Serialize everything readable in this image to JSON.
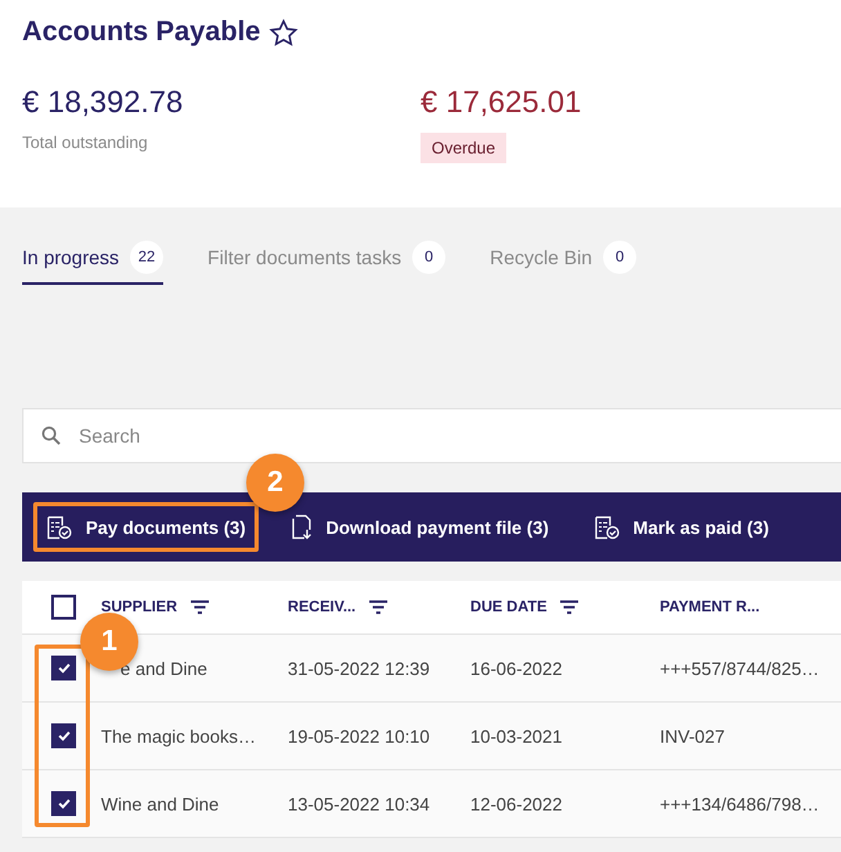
{
  "header": {
    "title": "Accounts Payable",
    "favorite": false
  },
  "summary": [
    {
      "amount": "€ 18,392.78",
      "label": "Total outstanding",
      "kind": "total"
    },
    {
      "amount": "€ 17,625.01",
      "label": "Overdue",
      "kind": "overdue"
    }
  ],
  "tabs": [
    {
      "label": "In progress",
      "count": "22",
      "selected": true
    },
    {
      "label": "Filter documents tasks",
      "count": "0",
      "selected": false
    },
    {
      "label": "Recycle Bin",
      "count": "0",
      "selected": false
    }
  ],
  "search": {
    "placeholder": "Search"
  },
  "actions": [
    {
      "label": "Pay documents (3)",
      "kind": "pay",
      "highlighted": true,
      "callout": "2"
    },
    {
      "label": "Download payment file (3)",
      "kind": "download",
      "highlighted": false
    },
    {
      "label": "Mark as paid (3)",
      "kind": "pay",
      "highlighted": false
    }
  ],
  "table": {
    "select_all_checked": false,
    "checkbox_callout": "1",
    "columns": [
      {
        "label": "SUPPLIER",
        "filter": true
      },
      {
        "label": "RECEIV...",
        "filter": true
      },
      {
        "label": "DUE DATE",
        "filter": true
      },
      {
        "label": "PAYMENT R...",
        "filter": false
      }
    ],
    "rows": [
      {
        "checked": true,
        "cells": [
          "e and Dine",
          "31-05-2022 12:39",
          "16-06-2022",
          "+++557/8744/825…"
        ]
      },
      {
        "checked": true,
        "cells": [
          "The magic books…",
          "19-05-2022 10:10",
          "10-03-2021",
          "INV-027"
        ]
      },
      {
        "checked": true,
        "cells": [
          "Wine and Dine",
          "13-05-2022 10:34",
          "12-06-2022",
          "+++134/6486/798…"
        ]
      }
    ]
  }
}
